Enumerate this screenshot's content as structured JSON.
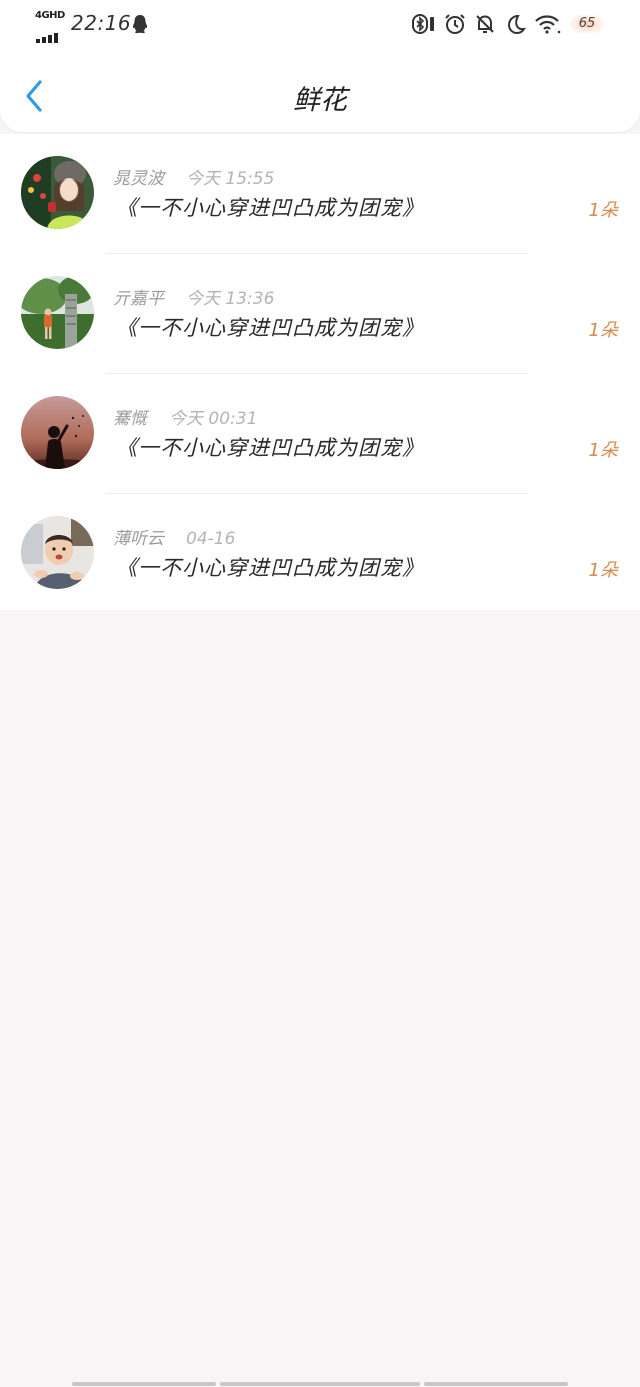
{
  "status_bar": {
    "network": "4GHD",
    "time": "22:16",
    "battery": "65",
    "icons": [
      "qq-icon",
      "bluetooth-icon",
      "alarm-icon",
      "mute-bell-icon",
      "moon-icon",
      "wifi-icon"
    ]
  },
  "header": {
    "title": "鲜花",
    "back_icon": "chevron-left-icon"
  },
  "colors": {
    "accent_back": "#2f9be6",
    "count_orange": "#d98a4a",
    "background": "#f7f5f6"
  },
  "items": [
    {
      "name": "晁灵波",
      "date": "今天 15:55",
      "book": "《一不小心穿进凹凸成为团宠》",
      "count": "1朵"
    },
    {
      "name": "亓嘉平",
      "date": "今天 13:36",
      "book": "《一不小心穿进凹凸成为团宠》",
      "count": "1朵"
    },
    {
      "name": "騫慨",
      "date": "今天 00:31",
      "book": "《一不小心穿进凹凸成为团宠》",
      "count": "1朵"
    },
    {
      "name": "薄听云",
      "date": "04-16",
      "book": "《一不小心穿进凹凸成为团宠》",
      "count": "1朵"
    }
  ]
}
